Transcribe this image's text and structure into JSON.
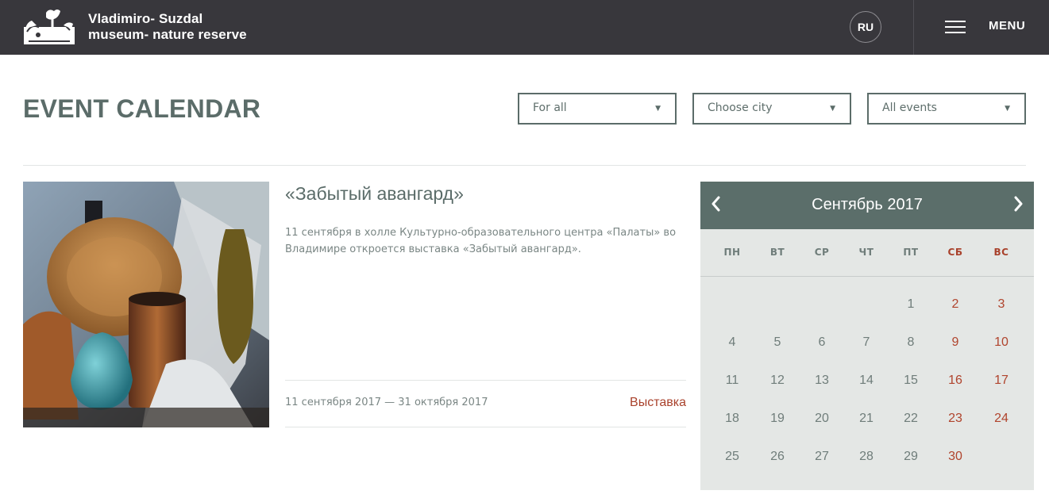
{
  "header": {
    "brand_line1": "Vladimiro- Suzdal",
    "brand_line2": "museum- nature reserve",
    "lang": "RU",
    "menu_label": "MENU",
    "logo_icon": "lion-logo-icon",
    "menu_icon": "hamburger-icon"
  },
  "page": {
    "title": "EVENT CALENDAR"
  },
  "filters": {
    "audience": "For all",
    "city": "Choose city",
    "events": "All events"
  },
  "event": {
    "title": "«Забытый авангард»",
    "description": "11 сентября в холле Культурно-образовательного центра «Палаты» во Владимире откроется выставка «Забытый авангард».",
    "dates": "11 сентября 2017 — 31 октября 2017",
    "type": "Выставка"
  },
  "calendar": {
    "month": "Сентябрь 2017",
    "weekdays": [
      "ПН",
      "ВТ",
      "СР",
      "ЧТ",
      "ПТ",
      "СБ",
      "ВС"
    ],
    "weeks": [
      [
        "",
        "",
        "",
        "",
        "1",
        "2",
        "3"
      ],
      [
        "4",
        "5",
        "6",
        "7",
        "8",
        "9",
        "10"
      ],
      [
        "11",
        "12",
        "13",
        "14",
        "15",
        "16",
        "17"
      ],
      [
        "18",
        "19",
        "20",
        "21",
        "22",
        "23",
        "24"
      ],
      [
        "25",
        "26",
        "27",
        "28",
        "29",
        "30",
        ""
      ]
    ],
    "weekend_color": "#a9422c",
    "header_color": "#5b6e6a"
  },
  "colors": {
    "topbar": "#38373c",
    "accent": "#5b6c69",
    "link": "#a9422c"
  }
}
